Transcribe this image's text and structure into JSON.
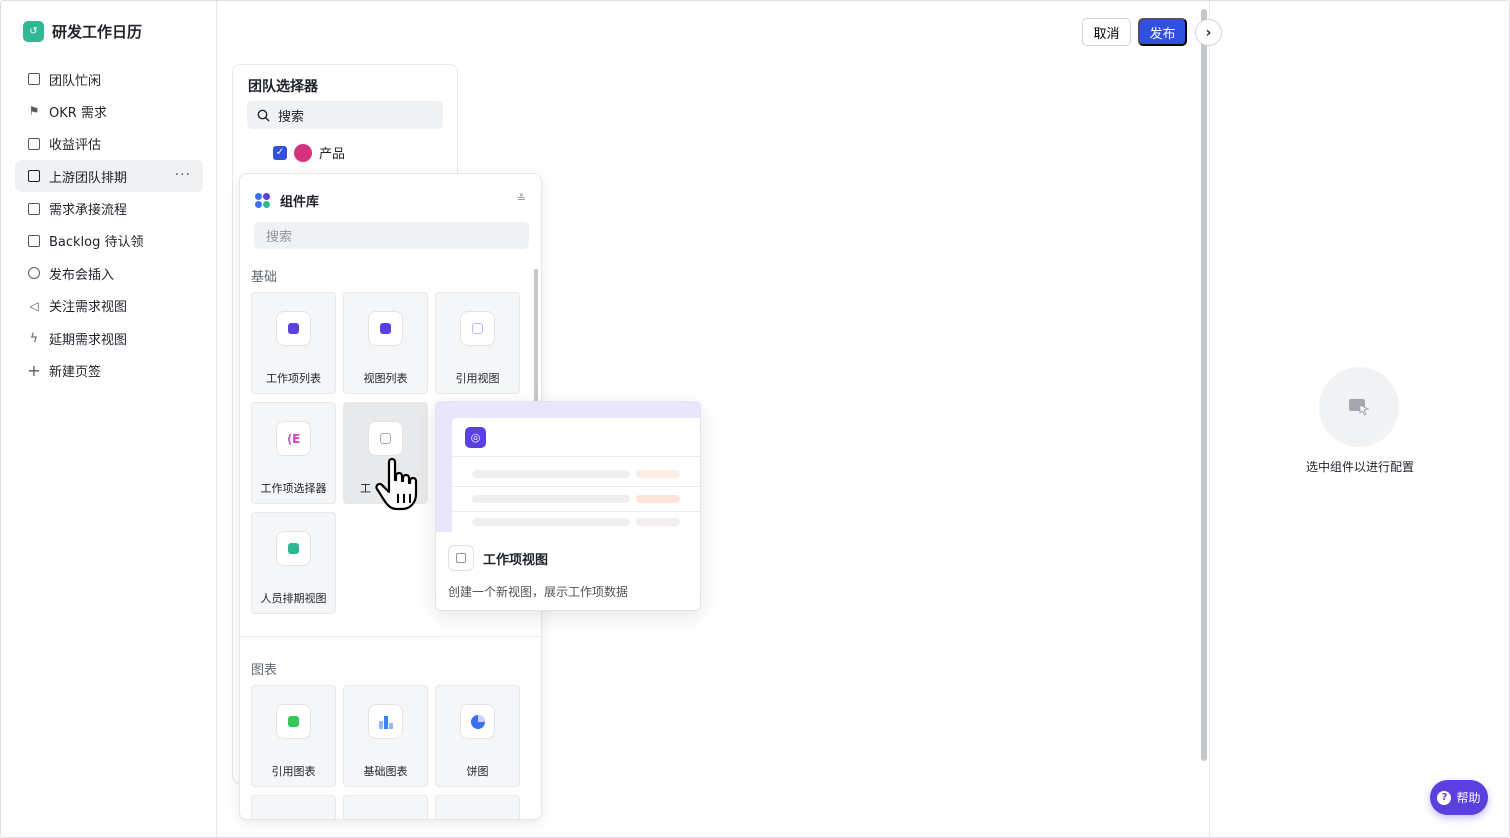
{
  "app": {
    "name": "研发工作日历"
  },
  "sidebar": {
    "items": [
      {
        "label": "团队忙闲",
        "icon": "calendar-icon"
      },
      {
        "label": "OKR 需求",
        "icon": "flag-icon"
      },
      {
        "label": "收益评估",
        "icon": "doc-icon"
      },
      {
        "label": "上游团队排期",
        "icon": "list-icon",
        "active": true,
        "more": "···"
      },
      {
        "label": "需求承接流程",
        "icon": "doc-icon"
      },
      {
        "label": "Backlog 待认领",
        "icon": "checkbox-icon"
      },
      {
        "label": "发布会插入",
        "icon": "upload-icon"
      },
      {
        "label": "关注需求视图",
        "icon": "megaphone-icon"
      },
      {
        "label": "延期需求视图",
        "icon": "lightning-icon"
      },
      {
        "label": "新建页签",
        "icon": "plus-icon"
      }
    ]
  },
  "toolbar": {
    "cancel_label": "取消",
    "publish_label": "发布",
    "expand_icon": "›"
  },
  "team_selector": {
    "title": "团队选择器",
    "search_placeholder": "搜索",
    "teams": [
      {
        "label": "产品",
        "checked": true,
        "color": "#d4317f"
      }
    ]
  },
  "component_library": {
    "title": "组件库",
    "search_placeholder": "搜索",
    "sections": [
      {
        "label": "基础",
        "items": [
          {
            "label": "工作项列表",
            "color": "#5b3fe0"
          },
          {
            "label": "视图列表",
            "color": "#5b3fe0"
          },
          {
            "label": "引用视图",
            "color": "#b6b9ff"
          },
          {
            "label": "工作项选择器",
            "color": "#c843c9"
          },
          {
            "label": "工作项视图",
            "color": "#a8a9b8",
            "hover": true,
            "visible_label": "工"
          },
          {
            "label": "人员排期视图",
            "color": "#2fb892"
          }
        ]
      },
      {
        "label": "图表",
        "items": [
          {
            "label": "引用图表",
            "color": "#34c759"
          },
          {
            "label": "基础图表",
            "color": "#3b82f6"
          },
          {
            "label": "饼图",
            "color": "#3b6ff0"
          }
        ]
      }
    ]
  },
  "preview_card": {
    "title": "工作项视图",
    "description": "创建一个新视图，展示工作项数据"
  },
  "config_panel": {
    "empty_text": "选中组件以进行配置"
  },
  "help": {
    "label": "帮助"
  },
  "colors": {
    "accent": "#3250e0",
    "brand": "#5b3fe0"
  }
}
